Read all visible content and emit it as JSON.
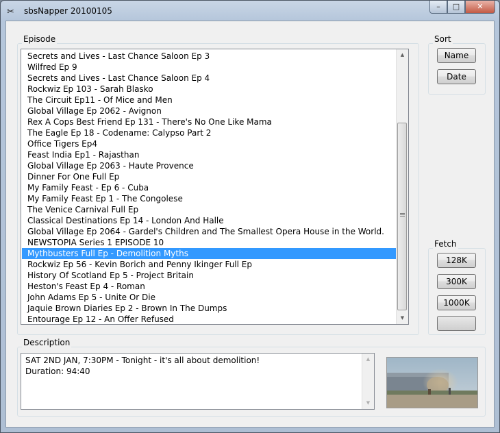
{
  "window": {
    "title": "sbsNapper 20100105",
    "minimize_label": "–",
    "maximize_label": "□",
    "close_label": "✕"
  },
  "episode": {
    "label": "Episode",
    "items": [
      "Secrets and Lives - Last Chance Saloon Ep 3",
      "Wilfred Ep 9",
      "Secrets and Lives - Last Chance Saloon Ep 4",
      "Rockwiz Ep 103 - Sarah Blasko",
      "The Circuit Ep11 - Of Mice and Men",
      "Global Village Ep 2062 - Avignon",
      "Rex A Cops Best Friend Ep 131 - There's No One Like Mama",
      "The Eagle Ep 18 - Codename: Calypso Part 2",
      "Office Tigers Ep4",
      "Feast India Ep1 - Rajasthan",
      "Global Village Ep 2063 - Haute Provence",
      "Dinner For One Full Ep",
      "My Family Feast - Ep 6 - Cuba",
      "My Family Feast Ep 1 - The Congolese",
      "The Venice Carnival Full Ep",
      "Classical Destinations Ep 14 - London And Halle",
      "Global Village Ep 2064 - Gardel's Children and The Smallest Opera House in the World.",
      "NEWSTOPIA Series 1 EPISODE 10",
      "Mythbusters Full Ep - Demolition Myths",
      "Rockwiz Ep 56 - Kevin Borich and Penny Ikinger Full Ep",
      "History Of Scotland Ep 5 - Project Britain",
      "Heston's Feast Ep 4 - Roman",
      "John Adams Ep 5 - Unite Or Die",
      "Jaquie Brown Diaries Ep 2 - Brown In The Dumps",
      "Entourage Ep 12 - An Offer Refused"
    ],
    "selected_index": 18
  },
  "sort": {
    "label": "Sort",
    "name_button": "Name",
    "date_button": "Date"
  },
  "fetch": {
    "label": "Fetch",
    "btn_128k": "128K",
    "btn_300k": "300K",
    "btn_1000k": "1000K",
    "progress": 0
  },
  "description": {
    "label": "Description",
    "line1": "SAT 2ND JAN, 7:30PM - Tonight - it's all about demolition!",
    "line2": "Duration: 94:40"
  },
  "colors": {
    "selection": "#3399ff",
    "window_frame": "#b5c6db"
  }
}
